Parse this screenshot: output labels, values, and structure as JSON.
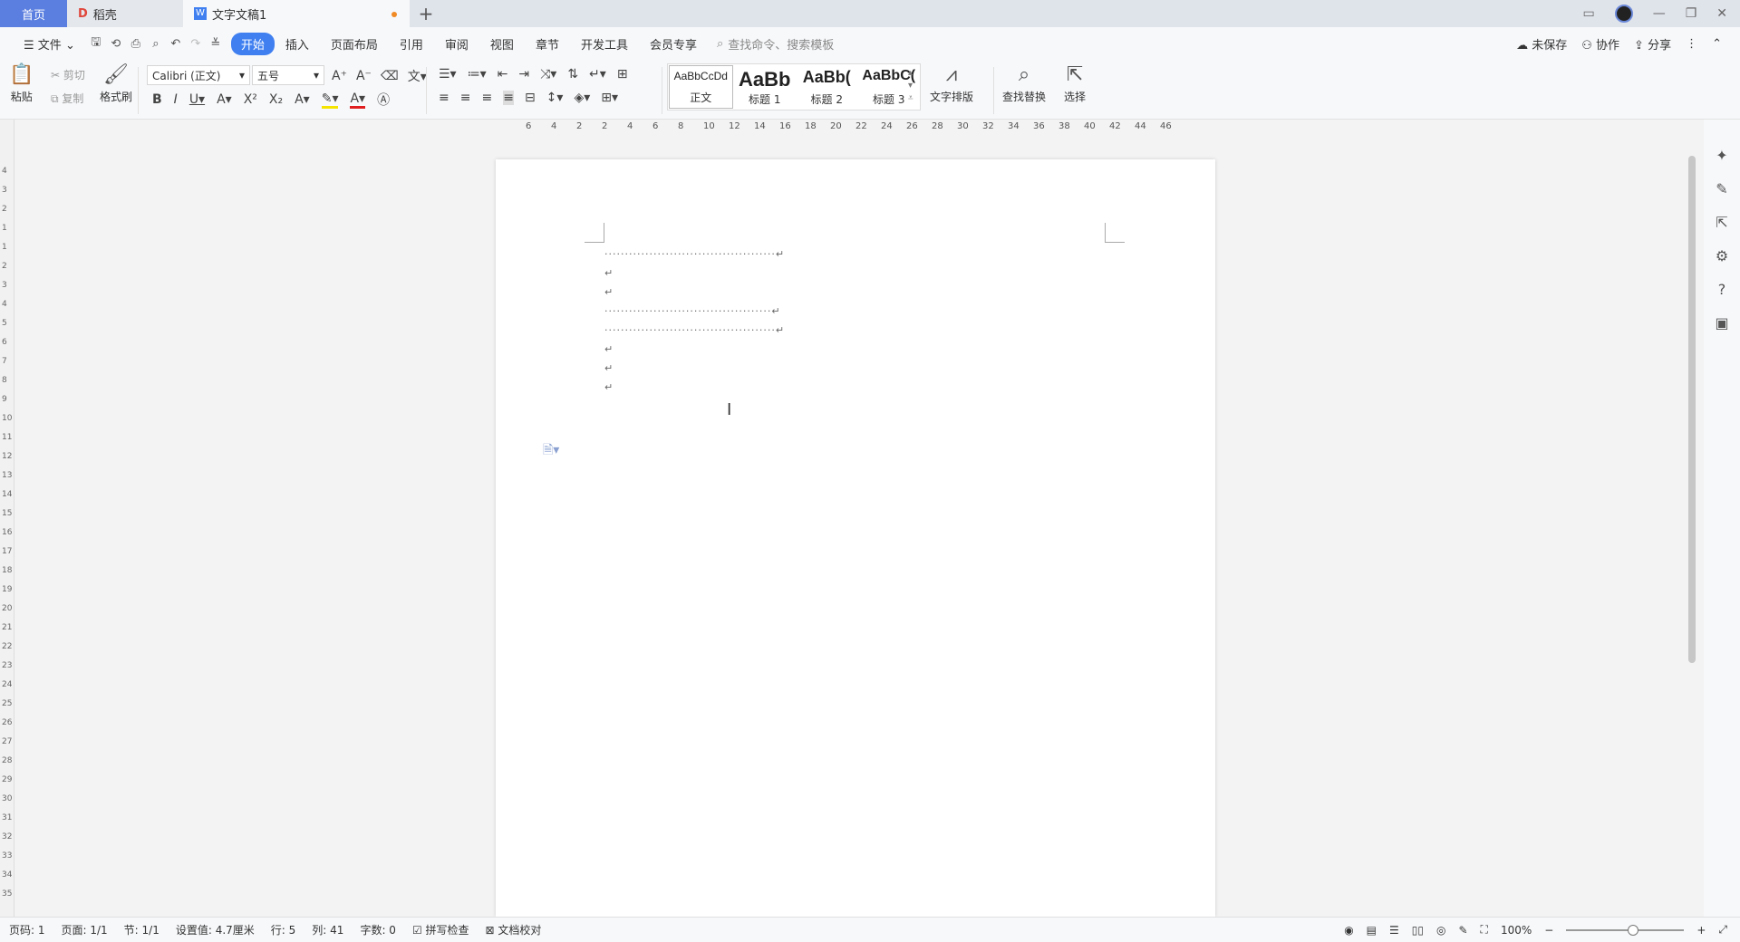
{
  "tabs": {
    "home": "首页",
    "daoke": "稻壳",
    "doc": "文字文稿1",
    "add": "+"
  },
  "menu": {
    "file": "文件",
    "items": [
      "开始",
      "插入",
      "页面布局",
      "引用",
      "审阅",
      "视图",
      "章节",
      "开发工具",
      "会员专享"
    ],
    "search_placeholder": "查找命令、搜索模板",
    "unsaved": "未保存",
    "collab": "协作",
    "share": "分享"
  },
  "ribbon": {
    "paste": "粘贴",
    "cut": "剪切",
    "copy": "复制",
    "format_painter": "格式刷",
    "font_name": "Calibri (正文)",
    "font_size": "五号",
    "styles": [
      {
        "sample": "AaBbCcDd",
        "name": "正文"
      },
      {
        "sample": "AaBb",
        "name": "标题 1"
      },
      {
        "sample": "AaBb(",
        "name": "标题 2"
      },
      {
        "sample": "AaBbC(",
        "name": "标题 3"
      }
    ],
    "text_layout": "文字排版",
    "find_replace": "查找替换",
    "select": "选择"
  },
  "ruler": {
    "h_labels": [
      "6",
      "4",
      "2",
      "2",
      "4",
      "6",
      "8",
      "10",
      "12",
      "14",
      "16",
      "18",
      "20",
      "22",
      "24",
      "26",
      "28",
      "30",
      "32",
      "34",
      "36",
      "38",
      "40",
      "42",
      "44",
      "46"
    ],
    "v_labels": [
      "4",
      "3",
      "2",
      "1",
      "1",
      "2",
      "3",
      "4",
      "5",
      "6",
      "7",
      "8",
      "9",
      "10",
      "11",
      "12",
      "13",
      "14",
      "15",
      "16",
      "17",
      "18",
      "19",
      "20",
      "21",
      "22",
      "23",
      "24",
      "25",
      "26",
      "27",
      "28",
      "29",
      "30",
      "31",
      "32",
      "33",
      "34",
      "35"
    ]
  },
  "document": {
    "lines": [
      "··········································↵",
      "↵",
      "↵",
      "·········································↵",
      "··········································↵",
      "↵",
      "↵",
      "↵"
    ]
  },
  "status": {
    "page_num": "页码: 1",
    "pages": "页面: 1/1",
    "section": "节: 1/1",
    "setting": "设置值: 4.7厘米",
    "row": "行: 5",
    "col": "列: 41",
    "word_count": "字数: 0",
    "spell": "拼写检查",
    "proofread": "文档校对",
    "zoom": "100%"
  },
  "colors": {
    "accent": "#3f7ff0",
    "home_tab": "#5b7fe0",
    "modified_dot": "#f08a24"
  }
}
